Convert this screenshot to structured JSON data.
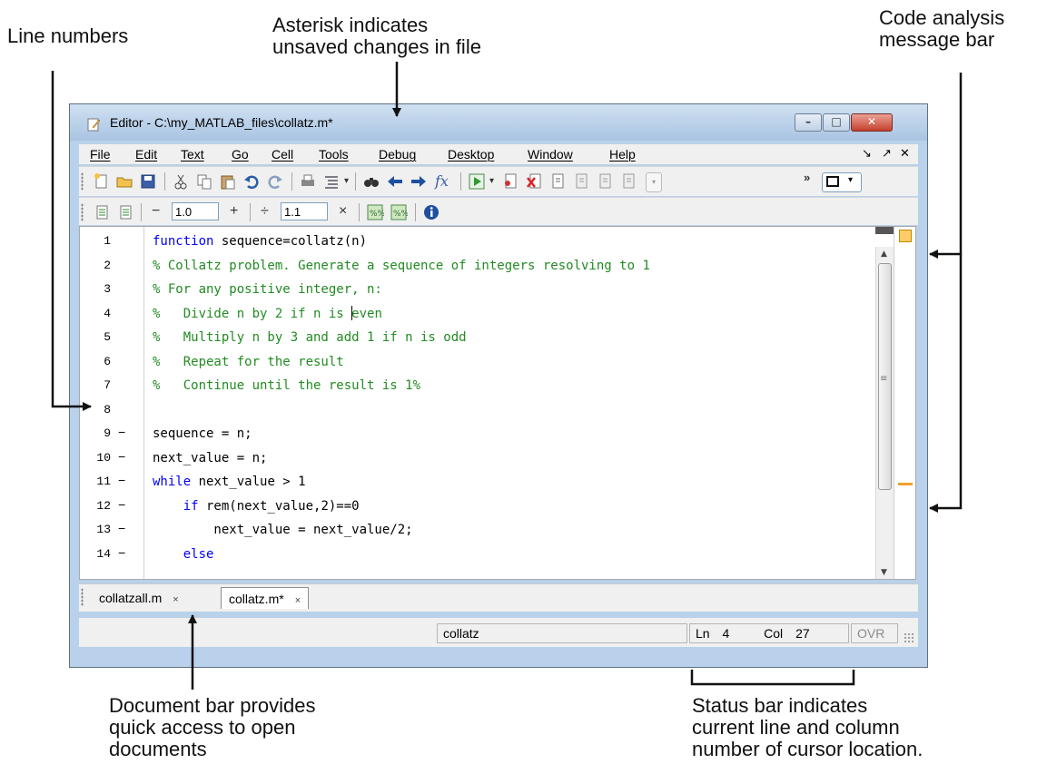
{
  "annotations": {
    "line_numbers": "Line numbers",
    "asterisk": [
      "Asterisk indicates",
      "unsaved changes in file"
    ],
    "code_analysis": [
      "Code analysis",
      "message bar"
    ],
    "document_bar": [
      "Document bar provides",
      "quick access to open",
      "documents"
    ],
    "status_bar": [
      "Status bar indicates",
      "current line and column",
      "number of cursor location."
    ]
  },
  "window": {
    "title": "Editor - C:\\my_MATLAB_files\\collatz.m*",
    "min_glyph": "–",
    "max_glyph": "□",
    "close_glyph": "✕"
  },
  "menu": {
    "items": [
      "File",
      "Edit",
      "Text",
      "Go",
      "Cell",
      "Tools",
      "Debug",
      "Desktop",
      "Window",
      "Help"
    ],
    "controls": [
      "↘",
      "↗",
      "✕"
    ]
  },
  "toolbar2": {
    "minus": "−",
    "value1": "1.0",
    "plus": "+",
    "divide": "÷",
    "value2": "1.1",
    "times": "×"
  },
  "code": {
    "lines": [
      {
        "n": "1",
        "dash": "",
        "kw": "function",
        "text": " sequence=collatz(n)",
        "type": "kw"
      },
      {
        "n": "2",
        "dash": "",
        "text": "% Collatz problem. Generate a sequence of integers resolving to 1",
        "type": "cm"
      },
      {
        "n": "3",
        "dash": "",
        "text": "% For any positive integer, n:",
        "type": "cm"
      },
      {
        "n": "4",
        "dash": "",
        "text_before": "%   Divide n by 2 if n is ",
        "text_after": "even",
        "type": "cm-caret"
      },
      {
        "n": "5",
        "dash": "",
        "text": "%   Multiply n by 3 and add 1 if n is odd",
        "type": "cm"
      },
      {
        "n": "6",
        "dash": "",
        "text": "%   Repeat for the result",
        "type": "cm"
      },
      {
        "n": "7",
        "dash": "",
        "text": "%   Continue until the result is 1%",
        "type": "cm"
      },
      {
        "n": "8",
        "dash": "",
        "text": "",
        "type": "plain"
      },
      {
        "n": "9",
        "dash": "−",
        "text": "sequence = n;",
        "type": "plain"
      },
      {
        "n": "10",
        "dash": "−",
        "text": "next_value = n;",
        "type": "plain"
      },
      {
        "n": "11",
        "dash": "−",
        "kw": "while",
        "text": " next_value > 1",
        "type": "kw"
      },
      {
        "n": "12",
        "dash": "−",
        "indent": "    ",
        "kw": "if",
        "text": " rem(next_value,2)==0",
        "type": "kw"
      },
      {
        "n": "13",
        "dash": "−",
        "text": "        next_value = next_value/2;",
        "type": "plain"
      },
      {
        "n": "14",
        "dash": "−",
        "indent": "    ",
        "kw": "else",
        "text": "",
        "type": "kw"
      }
    ]
  },
  "documents": {
    "tabs": [
      {
        "label": "collatzall.m",
        "close": "×",
        "active": false
      },
      {
        "label": "collatz.m*",
        "close": "×",
        "active": true
      }
    ]
  },
  "status": {
    "function": "collatz",
    "ln_label": "Ln",
    "ln_value": "4",
    "col_label": "Col",
    "col_value": "27",
    "ovr": "OVR"
  },
  "colors": {
    "keyword": "#0000ff",
    "comment": "#228b22",
    "analysis_indicator": "#ffcc66"
  }
}
